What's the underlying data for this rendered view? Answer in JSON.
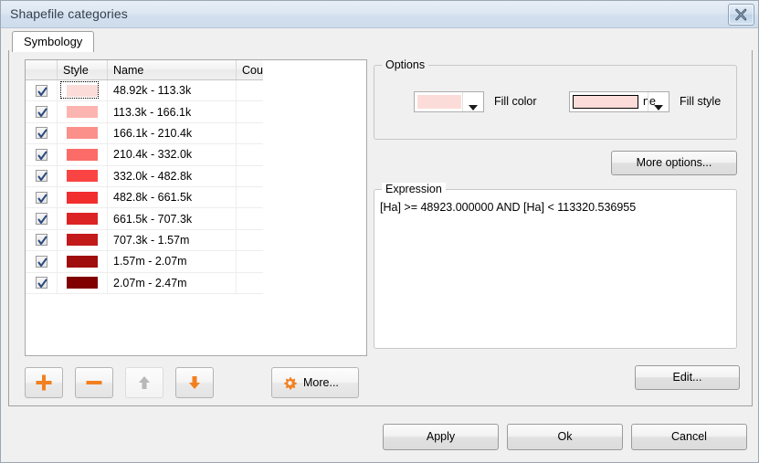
{
  "window": {
    "title": "Shapefile categories",
    "close_icon": "close-icon"
  },
  "tabs": [
    {
      "label": "Symbology",
      "active": true
    }
  ],
  "list": {
    "columns": [
      "",
      "Style",
      "Name",
      "Count"
    ],
    "rows": [
      {
        "checked": true,
        "color": "#fcdcd9",
        "name": "48.92k - 113.3k",
        "count": "",
        "selected": true
      },
      {
        "checked": true,
        "color": "#fcb4b0",
        "name": "113.3k - 166.1k",
        "count": "",
        "selected": false
      },
      {
        "checked": true,
        "color": "#fb8f8a",
        "name": "166.1k - 210.4k",
        "count": "",
        "selected": false
      },
      {
        "checked": true,
        "color": "#fb6c68",
        "name": "210.4k - 332.0k",
        "count": "",
        "selected": false
      },
      {
        "checked": true,
        "color": "#fa4444",
        "name": "332.0k - 482.8k",
        "count": "",
        "selected": false
      },
      {
        "checked": true,
        "color": "#f22d2d",
        "name": "482.8k - 661.5k",
        "count": "",
        "selected": false
      },
      {
        "checked": true,
        "color": "#dc2424",
        "name": "661.5k - 707.3k",
        "count": "",
        "selected": false
      },
      {
        "checked": true,
        "color": "#c31a1a",
        "name": "707.3k - 1.57m",
        "count": "",
        "selected": false
      },
      {
        "checked": true,
        "color": "#a00d0d",
        "name": "1.57m - 2.07m",
        "count": "",
        "selected": false
      },
      {
        "checked": true,
        "color": "#800000",
        "name": "2.07m - 2.47m",
        "count": "",
        "selected": false
      }
    ]
  },
  "toolbar": {
    "add_icon": "plus-icon",
    "remove_icon": "minus-icon",
    "move_up_icon": "arrow-up-icon",
    "move_down_icon": "arrow-down-icon",
    "more_label": "More...",
    "more_icon": "gear-icon"
  },
  "options": {
    "group_title": "Options",
    "fill_color": {
      "value": "#fcdcd9",
      "label": "Fill color",
      "arrow_icon": "chevron-down-icon"
    },
    "fill_style": {
      "swatch": "#fcdcd9",
      "value": "ne",
      "label": "Fill style",
      "arrow_icon": "chevron-down-icon"
    },
    "more_options_label": "More options..."
  },
  "expression": {
    "group_title": "Expression",
    "text": "[Ha] >= 48923.000000 AND [Ha] < 113320.536955",
    "edit_label": "Edit..."
  },
  "footer": {
    "apply_label": "Apply",
    "ok_label": "Ok",
    "cancel_label": "Cancel"
  },
  "colors": {
    "accent_orange": "#f28020",
    "titlebar": "#d3e0ee",
    "dialog_bg": "#f0f0f0"
  }
}
